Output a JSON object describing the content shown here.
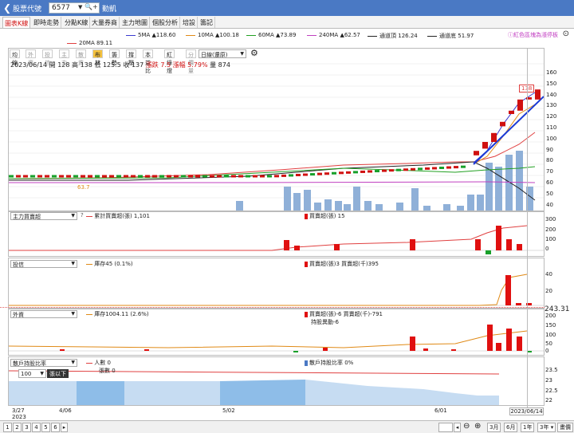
{
  "header": {
    "back_icon": "chevron-left-icon",
    "title": "股票代號",
    "code": "6577",
    "name": "勤凱"
  },
  "tabs": [
    "圖表K線",
    "即時走勢",
    "分點K線",
    "大量券商",
    "主力地圖",
    "個股分析",
    "培設",
    "籌記"
  ],
  "note": "ⓘ紅色區塊為漲停板",
  "ma": [
    {
      "label": "5MA",
      "arrow": "▲",
      "value": "118.60",
      "color": "#3a3ad0"
    },
    {
      "label": "10MA",
      "arrow": "▲",
      "value": "100.18",
      "color": "#e08a16"
    },
    {
      "label": "60MA",
      "arrow": "▲",
      "value": "73.89",
      "color": "#22a022"
    },
    {
      "label": "240MA",
      "arrow": "▲",
      "value": "62.57",
      "color": "#c040c0"
    },
    {
      "label": "通道頂",
      "arrow": "",
      "value": "126.24",
      "color": "#222"
    },
    {
      "label": "通道底",
      "arrow": "",
      "value": "51.97",
      "color": "#222"
    }
  ],
  "ma20": {
    "label": "20MA",
    "value": "89.11",
    "color": "#e04040"
  },
  "period_buttons": [
    "均線",
    "外資",
    "投信",
    "主力",
    "散資",
    "布林",
    "籌勢",
    "撐壓",
    "本益比",
    "紅綠燈",
    "分價量"
  ],
  "period_select": "日線(還原)",
  "info": {
    "date": "2023/06/14",
    "open_l": "開",
    "open": "128",
    "high_l": "高",
    "high": "138",
    "low_l": "低",
    "low": "125.5",
    "close_l": "收",
    "close": "137",
    "chg_l": "漲跌",
    "chg": "7.5",
    "pct_l": "漲幅",
    "pct": "5.79%",
    "vol_l": "量",
    "vol": "874"
  },
  "price_axis": [
    "160",
    "150",
    "140",
    "130",
    "120",
    "110",
    "100",
    "90",
    "80",
    "70",
    "60",
    "50",
    "40"
  ],
  "low_label": "63.7",
  "high_label": "138",
  "pane1": {
    "select": "主力買賣超",
    "t1": "累計買賣超(張) 1,101",
    "t2": "買賣超(張) 15",
    "axis": [
      "300",
      "200",
      "100",
      "0"
    ]
  },
  "pane2": {
    "select": "投信",
    "t1": "庫存45 (0.1%)",
    "t2": "買賣超(張)3 買賣超(千)395",
    "axis": [
      "40",
      "20"
    ],
    "cur": "243.31"
  },
  "pane3": {
    "select": "外資",
    "t1": "庫存1004.11 (2.6%)",
    "t2": "買賣超(張)-6 買賣超(千)-791",
    "t3": "持股異動-6",
    "axis": [
      "200",
      "150",
      "100",
      "50",
      "0"
    ]
  },
  "pane4": {
    "select": "散戶持股比率",
    "t1": "人數 0",
    "t2": "張數 0",
    "t3": "散戶持股比率 0%",
    "axis": [
      "23.5",
      "23",
      "22.5",
      "22"
    ],
    "threshold": "100",
    "threshold_btn": "張以下"
  },
  "x_labels": [
    "3/27",
    "2023",
    "4/06",
    "5/02",
    "6/01"
  ],
  "date_box": "2023/06/14",
  "pages": [
    "1",
    "2",
    "3",
    "4",
    "5",
    "6"
  ],
  "ranges": [
    "3月",
    "6月",
    "1年",
    "3年",
    "畫價"
  ],
  "colors": {
    "up": "#d01010",
    "down": "#17a02a",
    "vol": "#8fb0d8",
    "accent": "#4a79c4"
  },
  "chart_data": {
    "type": "bar",
    "candles_recent": [
      {
        "x": "6/05",
        "o": 78,
        "c": 82
      },
      {
        "x": "6/06",
        "o": 84,
        "c": 90
      },
      {
        "x": "6/07",
        "o": 90,
        "c": 98
      },
      {
        "x": "6/08",
        "o": 104,
        "c": 108
      },
      {
        "x": "6/09",
        "o": 115,
        "c": 118
      },
      {
        "x": "6/12",
        "o": 118,
        "c": 128
      },
      {
        "x": "6/13",
        "o": 128,
        "c": 130
      },
      {
        "x": "6/14",
        "o": 128,
        "c": 137
      }
    ],
    "volume_last": 874,
    "ylim": [
      35,
      165
    ]
  }
}
